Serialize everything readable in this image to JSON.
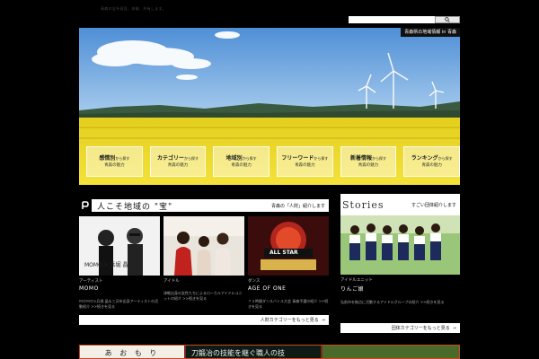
{
  "header": {
    "tagline": "青森の宝を発見、体験、共有します。",
    "search_placeholder": ""
  },
  "hero": {
    "badge": "青森県の地域情報 in 青森",
    "nav": [
      {
        "main": "感情別",
        "small": "から探す",
        "sub": "青森の魅力"
      },
      {
        "main": "カテゴリー",
        "small": "から探す",
        "sub": "青森の魅力"
      },
      {
        "main": "地域別",
        "small": "から探す",
        "sub": "青森の魅力"
      },
      {
        "main": "フリーワード",
        "small": "から探す",
        "sub": "青森の魅力"
      },
      {
        "main": "新着情報",
        "small": "から探す",
        "sub": "青森の魅力"
      },
      {
        "main": "ランキング",
        "small": "から探す",
        "sub": "青森の魅力"
      }
    ]
  },
  "people": {
    "title": "人こそ地域の \"宝\"",
    "subtitle": "青森の「人財」紹介します",
    "more": "人財カテゴリーをもっと見る",
    "cards": [
      {
        "cat": "アーティスト",
        "name": "MOMO",
        "desc": "ＭＯＭＯ×兵堀 晶＆三沢市出身アーティストの活動紹介 >>続きを見る",
        "photo_text": "MOMO × 兵堀 晶"
      },
      {
        "cat": "アイドル",
        "name": "",
        "desc": "津軽出身の女性たちによるローカルアイドルユニットの紹介 >>続きを見る",
        "photo_text": ""
      },
      {
        "cat": "ダンス",
        "name": "AGE OF ONE",
        "desc": "７２時間ダンスバトル大会 青森予選の紹介 >>続きを見る",
        "photo_text": "ALL STAR"
      }
    ]
  },
  "stories": {
    "title": "Stories",
    "subtitle": "すごい団体紹介します",
    "more": "団体カテゴリーをもっと見る",
    "card": {
      "cat": "アイドルユニット",
      "name": "りんご娘",
      "desc": "弘前市を拠点に活動するアイドルグループの紹介 >>続きを見る"
    }
  },
  "banner": {
    "left_text": "あ お も り",
    "mid_text": "刀鍛冶の技能を継ぐ職人の技"
  },
  "colors": {
    "background": "#000000",
    "sky": "#6fa6e0",
    "field": "#e8d020",
    "banner": "#7a2a18"
  }
}
